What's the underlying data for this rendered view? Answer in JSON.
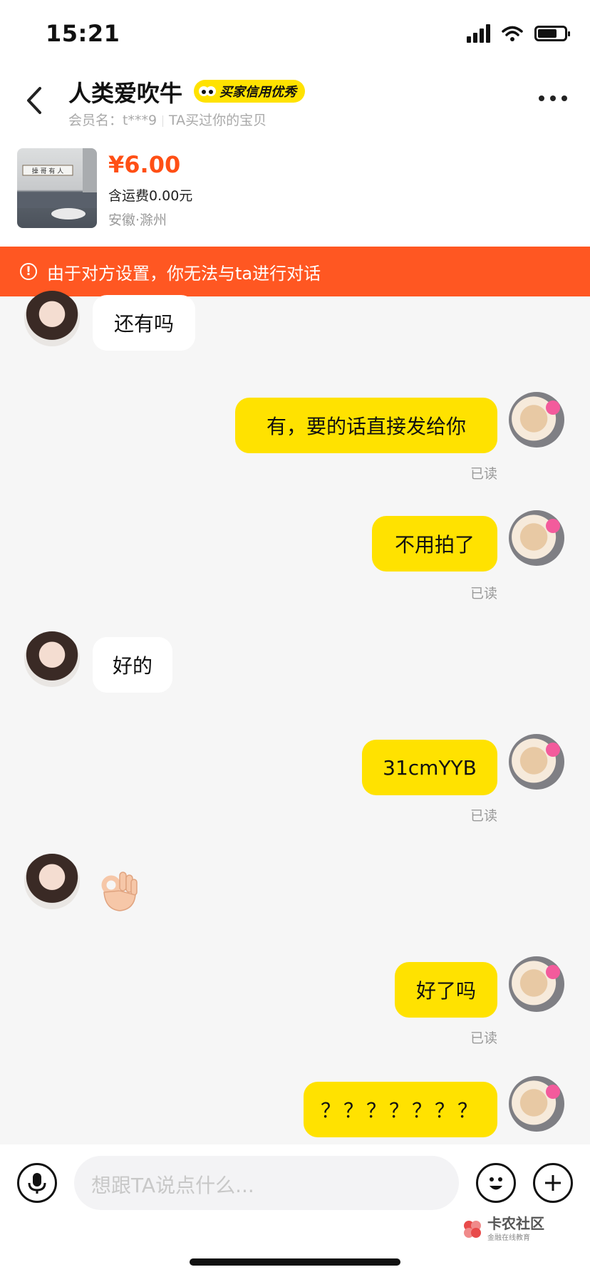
{
  "status_bar": {
    "time": "15:21"
  },
  "header": {
    "title": "人类爱吹牛",
    "badge": "买家信用优秀",
    "member_label": "会员名：t***9",
    "purchase_note": "TA买过你的宝贝"
  },
  "product": {
    "price": "¥6.00",
    "shipping": "含运费0.00元",
    "location": "安徽·滁州",
    "painting_text": "操 哥 有 人"
  },
  "warning": {
    "text": "由于对方设置，你无法与ta进行对话"
  },
  "messages": [
    {
      "text": "还有吗",
      "side": "in"
    },
    {
      "text": "有，要的话直接发给你",
      "side": "out",
      "status": "已读"
    },
    {
      "text": "不用拍了",
      "side": "out",
      "status": "已读"
    },
    {
      "text": "好的",
      "side": "in"
    },
    {
      "text": "31cmYYB",
      "side": "out",
      "status": "已读"
    },
    {
      "text": "👌",
      "side": "in",
      "type": "ok-hand-emoji"
    },
    {
      "text": "好了吗",
      "side": "out",
      "status": "已读"
    },
    {
      "text": "？？？？？？？",
      "side": "out"
    }
  ],
  "input": {
    "placeholder": "想跟TA说点什么..."
  },
  "watermark": {
    "brand": "卡农社区",
    "tagline": "金融在线教育"
  },
  "colors": {
    "accent": "#ffe200",
    "warning": "#ff5722",
    "price": "#ff4f15"
  }
}
